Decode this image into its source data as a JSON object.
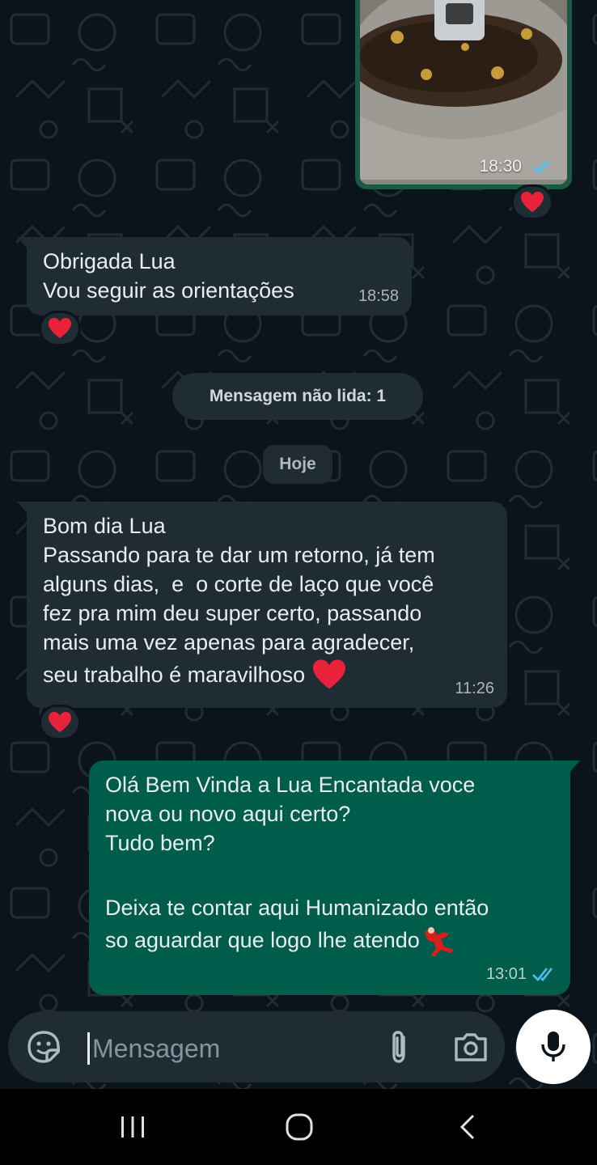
{
  "messages": {
    "image_msg": {
      "time": "18:30",
      "reaction": "heart"
    },
    "msg1": {
      "lines": [
        "Obrigada Lua",
        "Vou seguir as orientações"
      ],
      "time": "18:58",
      "reaction": "heart"
    },
    "unread_divider": "Mensagem não lida: 1",
    "date_divider": "Hoje",
    "msg2": {
      "lines": [
        "Bom dia Lua",
        "Passando para te dar um retorno, já tem",
        "alguns dias,  e  o corte de laço que você",
        "fez pra mim deu super certo, passando",
        "mais uma vez apenas para agradecer,",
        "seu trabalho é maravilhoso"
      ],
      "time": "11:26",
      "reaction": "heart"
    },
    "msg3": {
      "lines": [
        "Olá Bem Vinda a Lua Encantada voce",
        "nova ou novo aqui certo?",
        "Tudo bem?",
        "",
        "Deixa te contar aqui Humanizado então",
        "so aguardar que logo lhe atendo"
      ],
      "time": "13:01"
    }
  },
  "input": {
    "placeholder": "Mensagem"
  },
  "icons": {
    "emoji": "sticker-icon",
    "attach": "paperclip-icon",
    "camera": "camera-icon",
    "mic": "microphone-icon",
    "nav_recents": "recents-icon",
    "nav_home": "home-icon",
    "nav_back": "back-icon"
  },
  "colors": {
    "background": "#0b141a",
    "incoming_bubble": "#1f2c34",
    "outgoing_bubble": "#005c4b",
    "read_ticks": "#53bdeb",
    "heart": "#e8223a"
  }
}
